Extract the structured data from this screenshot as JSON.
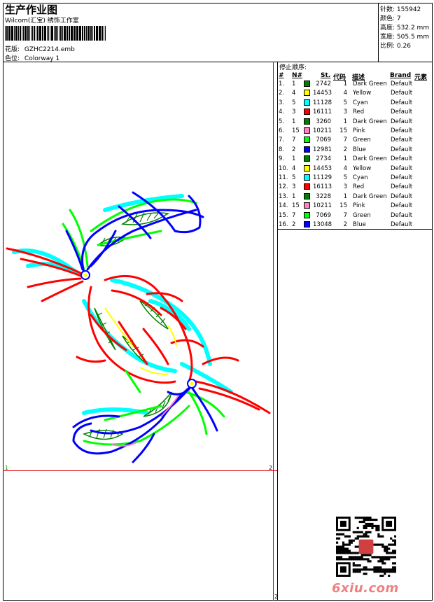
{
  "header": {
    "title": "生产作业图",
    "company": "Wilcom(汇宝) 绣饰工作室",
    "design_label": "花版:",
    "design_value": "GZHC2214.emb",
    "colorway_label": "色位:",
    "colorway_value": "Colorway 1"
  },
  "info": [
    {
      "label": "针数:",
      "value": "155942"
    },
    {
      "label": "颜色:",
      "value": "7"
    },
    {
      "label": "高度:",
      "value": "532.2 mm"
    },
    {
      "label": "宽度:",
      "value": "505.5 mm"
    },
    {
      "label": "比例:",
      "value": "0.26"
    }
  ],
  "stop_sequence": {
    "title": "停止顺序:",
    "headers": [
      "#",
      "N#",
      "St.",
      "代码",
      "描述",
      "Brand",
      "元素"
    ],
    "rows": [
      {
        "no": "1.",
        "n": "1",
        "color": "#008000",
        "st": "2742",
        "code": "1",
        "desc": "Dark Green",
        "brand": "Default"
      },
      {
        "no": "2.",
        "n": "4",
        "color": "#ffff00",
        "st": "14453",
        "code": "4",
        "desc": "Yellow",
        "brand": "Default"
      },
      {
        "no": "3.",
        "n": "5",
        "color": "#00ffff",
        "st": "11128",
        "code": "5",
        "desc": "Cyan",
        "brand": "Default"
      },
      {
        "no": "4.",
        "n": "3",
        "color": "#ff0000",
        "st": "16111",
        "code": "3",
        "desc": "Red",
        "brand": "Default"
      },
      {
        "no": "5.",
        "n": "1",
        "color": "#008000",
        "st": "3260",
        "code": "1",
        "desc": "Dark Green",
        "brand": "Default"
      },
      {
        "no": "6.",
        "n": "15",
        "color": "#ff80c0",
        "st": "10211",
        "code": "15",
        "desc": "Pink",
        "brand": "Default"
      },
      {
        "no": "7.",
        "n": "7",
        "color": "#00ff00",
        "st": "7069",
        "code": "7",
        "desc": "Green",
        "brand": "Default"
      },
      {
        "no": "8.",
        "n": "2",
        "color": "#0000ff",
        "st": "12981",
        "code": "2",
        "desc": "Blue",
        "brand": "Default"
      },
      {
        "no": "9.",
        "n": "1",
        "color": "#008000",
        "st": "2734",
        "code": "1",
        "desc": "Dark Green",
        "brand": "Default"
      },
      {
        "no": "10.",
        "n": "4",
        "color": "#ffff00",
        "st": "14453",
        "code": "4",
        "desc": "Yellow",
        "brand": "Default"
      },
      {
        "no": "11.",
        "n": "5",
        "color": "#00ffff",
        "st": "11129",
        "code": "5",
        "desc": "Cyan",
        "brand": "Default"
      },
      {
        "no": "12.",
        "n": "3",
        "color": "#ff0000",
        "st": "16113",
        "code": "3",
        "desc": "Red",
        "brand": "Default"
      },
      {
        "no": "13.",
        "n": "1",
        "color": "#008000",
        "st": "3228",
        "code": "1",
        "desc": "Dark Green",
        "brand": "Default"
      },
      {
        "no": "14.",
        "n": "15",
        "color": "#ff80c0",
        "st": "10211",
        "code": "15",
        "desc": "Pink",
        "brand": "Default"
      },
      {
        "no": "15.",
        "n": "7",
        "color": "#00ff00",
        "st": "7069",
        "code": "7",
        "desc": "Green",
        "brand": "Default"
      },
      {
        "no": "16.",
        "n": "2",
        "color": "#0000ff",
        "st": "13048",
        "code": "2",
        "desc": "Blue",
        "brand": "Default"
      }
    ]
  },
  "page_markers": {
    "green_1": "1",
    "red_2_top": "2",
    "red_2_bottom": "2"
  },
  "watermark": "6xiu.com",
  "icons": {
    "barcode": "barcode-icon",
    "qr": "qr-code-icon",
    "seal": "seal-icon"
  }
}
